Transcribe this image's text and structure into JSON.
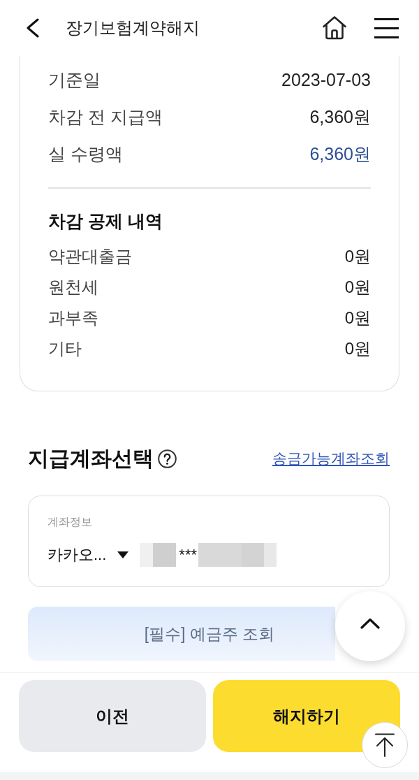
{
  "header": {
    "title": "장기보험계약해지"
  },
  "summary": {
    "rows": [
      {
        "label": "기준일",
        "value": "2023-07-03",
        "highlight": false
      },
      {
        "label": "차감 전 지급액",
        "value": "6,360원",
        "highlight": false
      },
      {
        "label": "실 수령액",
        "value": "6,360원",
        "highlight": true
      }
    ],
    "deductions": {
      "title": "차감 공제 내역",
      "rows": [
        {
          "label": "약관대출금",
          "value": "0원"
        },
        {
          "label": "원천세",
          "value": "0원"
        },
        {
          "label": "과부족",
          "value": "0원"
        },
        {
          "label": "기타",
          "value": "0원"
        }
      ]
    }
  },
  "account_section": {
    "title": "지급계좌선택",
    "link": "송금가능계좌조회",
    "field": {
      "label": "계좌정보",
      "bank": "카카오...",
      "number_masked": "***"
    }
  },
  "holder_check_button": {
    "label": "[필수] 예금주 조회"
  },
  "buttons": [
    {
      "label": "이전",
      "kind": "secondary"
    },
    {
      "label": "해지하기",
      "kind": "primary"
    }
  ]
}
